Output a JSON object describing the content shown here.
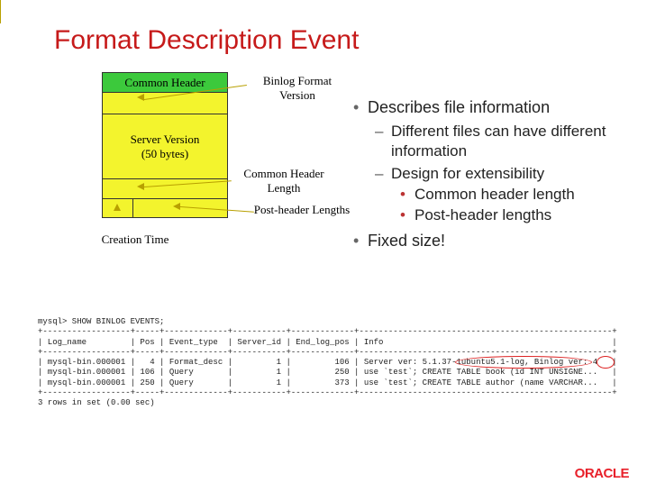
{
  "title": "Format Description Event",
  "diagram": {
    "header": "Common Header",
    "binlog_format_version_cell": "",
    "server_version_line1": "Server Version",
    "server_version_line2": "(50 bytes)",
    "common_header_length_cell": "",
    "creation_time_cell": "",
    "post_header_lengths_cell": ""
  },
  "labels": {
    "binlog_format_version": "Binlog Format Version",
    "common_header_length": "Common Header Length",
    "post_header_lengths": "Post-header Lengths",
    "creation_time": "Creation Time"
  },
  "bullets": {
    "b1": "Describes file information",
    "b1a": "Different files can have different information",
    "b1b": "Design for extensibility",
    "b1b1": "Common header length",
    "b1b2": "Post-header lengths",
    "b2": "Fixed size!"
  },
  "terminal": "mysql> SHOW BINLOG EVENTS;\n+------------------+-----+-------------+-----------+-------------+----------------------------------------------------+\n| Log_name         | Pos | Event_type  | Server_id | End_log_pos | Info                                               |\n+------------------+-----+-------------+-----------+-------------+----------------------------------------------------+\n| mysql-bin.000001 |   4 | Format_desc |         1 |         106 | Server ver: 5.1.37-1ubuntu5.1-log, Binlog ver: 4   |\n| mysql-bin.000001 | 106 | Query       |         1 |         250 | use `test`; CREATE TABLE book (id INT UNSIGNE...   |\n| mysql-bin.000001 | 250 | Query       |         1 |         373 | use `test`; CREATE TABLE author (name VARCHAR...   |\n+------------------+-----+-------------+-----------+-------------+----------------------------------------------------+\n3 rows in set (0.00 sec)",
  "chart_data": {
    "type": "table",
    "command": "SHOW BINLOG EVENTS",
    "columns": [
      "Log_name",
      "Pos",
      "Event_type",
      "Server_id",
      "End_log_pos",
      "Info"
    ],
    "rows": [
      [
        "mysql-bin.000001",
        4,
        "Format_desc",
        1,
        106,
        "Server ver: 5.1.37-1ubuntu5.1-log, Binlog ver: 4"
      ],
      [
        "mysql-bin.000001",
        106,
        "Query",
        1,
        250,
        "use `test`; CREATE TABLE book (id INT UNSIGNE..."
      ],
      [
        "mysql-bin.000001",
        250,
        "Query",
        1,
        373,
        "use `test`; CREATE TABLE author (name VARCHAR..."
      ]
    ],
    "footer": "3 rows in set (0.00 sec)",
    "highlights": [
      "5.1.37-1ubuntu5.1-log",
      "4"
    ]
  },
  "logo": "ORACLE"
}
